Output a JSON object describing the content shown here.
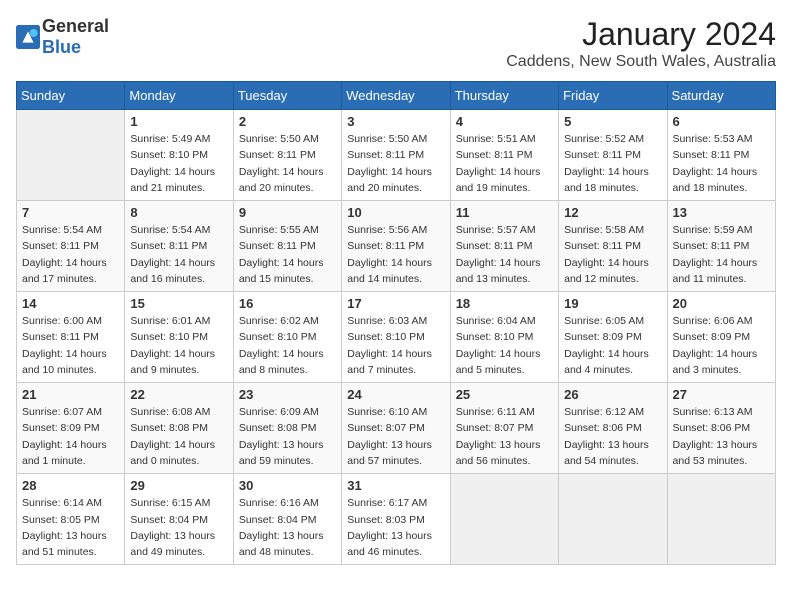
{
  "header": {
    "logo_general": "General",
    "logo_blue": "Blue",
    "month": "January 2024",
    "location": "Caddens, New South Wales, Australia"
  },
  "days_of_week": [
    "Sunday",
    "Monday",
    "Tuesday",
    "Wednesday",
    "Thursday",
    "Friday",
    "Saturday"
  ],
  "weeks": [
    [
      {
        "day": "",
        "info": ""
      },
      {
        "day": "1",
        "info": "Sunrise: 5:49 AM\nSunset: 8:10 PM\nDaylight: 14 hours\nand 21 minutes."
      },
      {
        "day": "2",
        "info": "Sunrise: 5:50 AM\nSunset: 8:11 PM\nDaylight: 14 hours\nand 20 minutes."
      },
      {
        "day": "3",
        "info": "Sunrise: 5:50 AM\nSunset: 8:11 PM\nDaylight: 14 hours\nand 20 minutes."
      },
      {
        "day": "4",
        "info": "Sunrise: 5:51 AM\nSunset: 8:11 PM\nDaylight: 14 hours\nand 19 minutes."
      },
      {
        "day": "5",
        "info": "Sunrise: 5:52 AM\nSunset: 8:11 PM\nDaylight: 14 hours\nand 18 minutes."
      },
      {
        "day": "6",
        "info": "Sunrise: 5:53 AM\nSunset: 8:11 PM\nDaylight: 14 hours\nand 18 minutes."
      }
    ],
    [
      {
        "day": "7",
        "info": "Sunrise: 5:54 AM\nSunset: 8:11 PM\nDaylight: 14 hours\nand 17 minutes."
      },
      {
        "day": "8",
        "info": "Sunrise: 5:54 AM\nSunset: 8:11 PM\nDaylight: 14 hours\nand 16 minutes."
      },
      {
        "day": "9",
        "info": "Sunrise: 5:55 AM\nSunset: 8:11 PM\nDaylight: 14 hours\nand 15 minutes."
      },
      {
        "day": "10",
        "info": "Sunrise: 5:56 AM\nSunset: 8:11 PM\nDaylight: 14 hours\nand 14 minutes."
      },
      {
        "day": "11",
        "info": "Sunrise: 5:57 AM\nSunset: 8:11 PM\nDaylight: 14 hours\nand 13 minutes."
      },
      {
        "day": "12",
        "info": "Sunrise: 5:58 AM\nSunset: 8:11 PM\nDaylight: 14 hours\nand 12 minutes."
      },
      {
        "day": "13",
        "info": "Sunrise: 5:59 AM\nSunset: 8:11 PM\nDaylight: 14 hours\nand 11 minutes."
      }
    ],
    [
      {
        "day": "14",
        "info": "Sunrise: 6:00 AM\nSunset: 8:11 PM\nDaylight: 14 hours\nand 10 minutes."
      },
      {
        "day": "15",
        "info": "Sunrise: 6:01 AM\nSunset: 8:10 PM\nDaylight: 14 hours\nand 9 minutes."
      },
      {
        "day": "16",
        "info": "Sunrise: 6:02 AM\nSunset: 8:10 PM\nDaylight: 14 hours\nand 8 minutes."
      },
      {
        "day": "17",
        "info": "Sunrise: 6:03 AM\nSunset: 8:10 PM\nDaylight: 14 hours\nand 7 minutes."
      },
      {
        "day": "18",
        "info": "Sunrise: 6:04 AM\nSunset: 8:10 PM\nDaylight: 14 hours\nand 5 minutes."
      },
      {
        "day": "19",
        "info": "Sunrise: 6:05 AM\nSunset: 8:09 PM\nDaylight: 14 hours\nand 4 minutes."
      },
      {
        "day": "20",
        "info": "Sunrise: 6:06 AM\nSunset: 8:09 PM\nDaylight: 14 hours\nand 3 minutes."
      }
    ],
    [
      {
        "day": "21",
        "info": "Sunrise: 6:07 AM\nSunset: 8:09 PM\nDaylight: 14 hours\nand 1 minute."
      },
      {
        "day": "22",
        "info": "Sunrise: 6:08 AM\nSunset: 8:08 PM\nDaylight: 14 hours\nand 0 minutes."
      },
      {
        "day": "23",
        "info": "Sunrise: 6:09 AM\nSunset: 8:08 PM\nDaylight: 13 hours\nand 59 minutes."
      },
      {
        "day": "24",
        "info": "Sunrise: 6:10 AM\nSunset: 8:07 PM\nDaylight: 13 hours\nand 57 minutes."
      },
      {
        "day": "25",
        "info": "Sunrise: 6:11 AM\nSunset: 8:07 PM\nDaylight: 13 hours\nand 56 minutes."
      },
      {
        "day": "26",
        "info": "Sunrise: 6:12 AM\nSunset: 8:06 PM\nDaylight: 13 hours\nand 54 minutes."
      },
      {
        "day": "27",
        "info": "Sunrise: 6:13 AM\nSunset: 8:06 PM\nDaylight: 13 hours\nand 53 minutes."
      }
    ],
    [
      {
        "day": "28",
        "info": "Sunrise: 6:14 AM\nSunset: 8:05 PM\nDaylight: 13 hours\nand 51 minutes."
      },
      {
        "day": "29",
        "info": "Sunrise: 6:15 AM\nSunset: 8:04 PM\nDaylight: 13 hours\nand 49 minutes."
      },
      {
        "day": "30",
        "info": "Sunrise: 6:16 AM\nSunset: 8:04 PM\nDaylight: 13 hours\nand 48 minutes."
      },
      {
        "day": "31",
        "info": "Sunrise: 6:17 AM\nSunset: 8:03 PM\nDaylight: 13 hours\nand 46 minutes."
      },
      {
        "day": "",
        "info": ""
      },
      {
        "day": "",
        "info": ""
      },
      {
        "day": "",
        "info": ""
      }
    ]
  ]
}
